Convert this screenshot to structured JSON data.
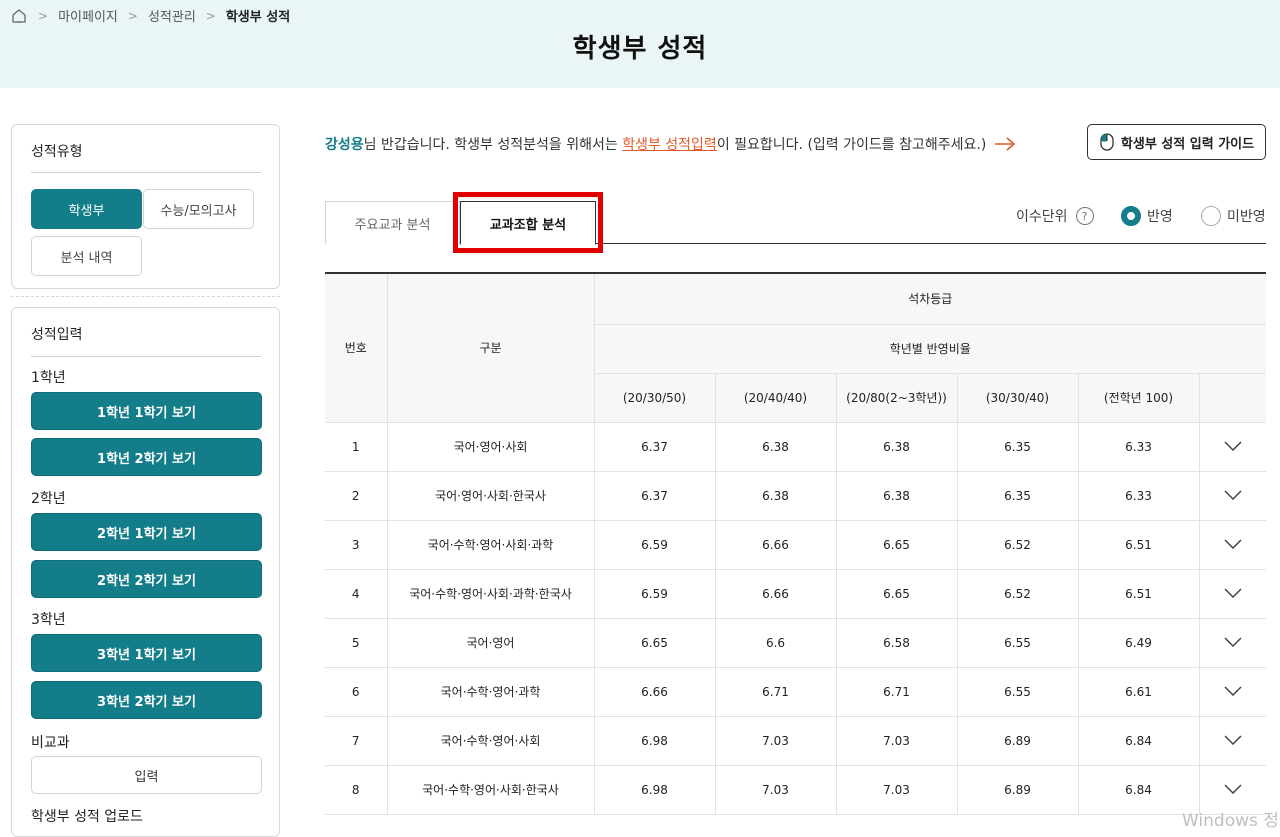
{
  "breadcrumb": {
    "items": [
      "마이페이지",
      "성적관리",
      "학생부 성적"
    ]
  },
  "page_title": "학생부 성적",
  "sidebar": {
    "type_title": "성적유형",
    "type_buttons": [
      "학생부",
      "수능/모의고사",
      "분석 내역"
    ],
    "input_title": "성적입력",
    "grades": [
      {
        "label": "1학년",
        "buttons": [
          "1학년 1학기 보기",
          "1학년 2학기 보기"
        ]
      },
      {
        "label": "2학년",
        "buttons": [
          "2학년 1학기 보기",
          "2학년 2학기 보기"
        ]
      },
      {
        "label": "3학년",
        "buttons": [
          "3학년 1학기 보기",
          "3학년 2학기 보기"
        ]
      }
    ],
    "nonsubject_label": "비교과",
    "nonsubject_button": "입력",
    "upload_label": "학생부 성적 업로드"
  },
  "welcome": {
    "name": "강성용",
    "text1": "님 반갑습니다. 학생부 성적분석을 위해서는 ",
    "link": "학생부 성적입력",
    "text2": "이 필요합니다. (입력 가이드를 참고해주세요.)"
  },
  "guide_button": "학생부 성적 입력 가이드",
  "tabs": [
    "주요교과 분석",
    "교과조합 분석"
  ],
  "units": {
    "label": "이수단위",
    "help": "?",
    "options": [
      "반영",
      "미반영"
    ],
    "selected": "반영"
  },
  "table": {
    "col_no": "번호",
    "col_category": "구분",
    "group_header": "석차등급",
    "sub_header": "학년별 반영비율",
    "ratio_headers": [
      "(20/30/50)",
      "(20/40/40)",
      "(20/80(2~3학년))",
      "(30/30/40)",
      "(전학년 100)"
    ],
    "rows": [
      {
        "no": "1",
        "category": "국어·영어·사회",
        "values": [
          "6.37",
          "6.38",
          "6.38",
          "6.35",
          "6.33"
        ]
      },
      {
        "no": "2",
        "category": "국어·영어·사회·한국사",
        "values": [
          "6.37",
          "6.38",
          "6.38",
          "6.35",
          "6.33"
        ]
      },
      {
        "no": "3",
        "category": "국어·수학·영어·사회·과학",
        "values": [
          "6.59",
          "6.66",
          "6.65",
          "6.52",
          "6.51"
        ]
      },
      {
        "no": "4",
        "category": "국어·수학·영어·사회·과학·한국사",
        "values": [
          "6.59",
          "6.66",
          "6.65",
          "6.52",
          "6.51"
        ]
      },
      {
        "no": "5",
        "category": "국어·영어",
        "values": [
          "6.65",
          "6.6",
          "6.58",
          "6.55",
          "6.49"
        ]
      },
      {
        "no": "6",
        "category": "국어·수학·영어·과학",
        "values": [
          "6.66",
          "6.71",
          "6.71",
          "6.55",
          "6.61"
        ]
      },
      {
        "no": "7",
        "category": "국어·수학·영어·사회",
        "values": [
          "6.98",
          "7.03",
          "7.03",
          "6.89",
          "6.84"
        ]
      },
      {
        "no": "8",
        "category": "국어·수학·영어·사회·한국사",
        "values": [
          "6.98",
          "7.03",
          "7.03",
          "6.89",
          "6.84"
        ]
      }
    ]
  },
  "watermark": "Windows 정",
  "colors": {
    "accent": "#137d8a",
    "link": "#e05a2b",
    "highlight": "#e00000",
    "header_bg": "#eaf6f6"
  }
}
